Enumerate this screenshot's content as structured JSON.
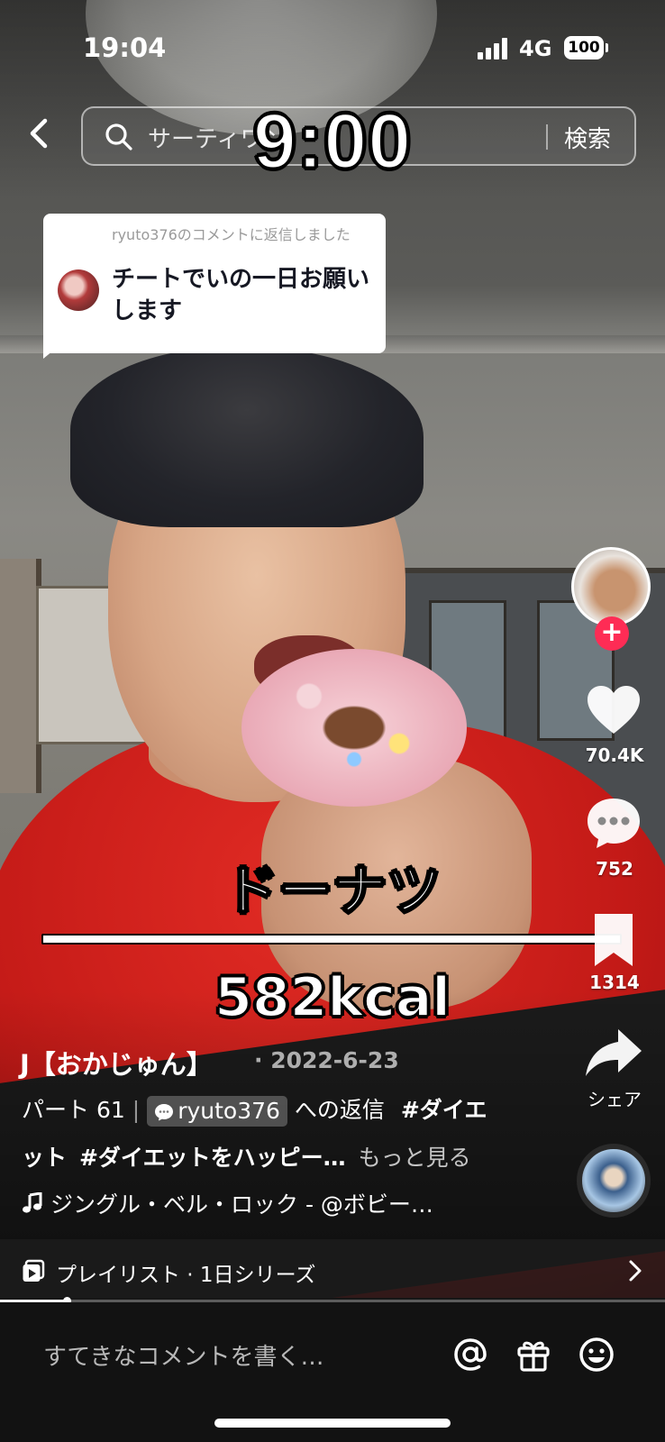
{
  "status_bar": {
    "time": "19:04",
    "network": "4G",
    "battery": "100"
  },
  "search": {
    "query": "サーティワン",
    "button_label": "検索"
  },
  "video_overlay": {
    "timer": "9:00",
    "food_name": "ドーナツ",
    "calories": "582kcal"
  },
  "reply_card": {
    "meta": "ryuto376のコメントに返信しました",
    "text": "チートでいの一日お願いします"
  },
  "actions": {
    "likes": "70.4K",
    "comments": "752",
    "saves": "1314",
    "share_label": "シェア"
  },
  "post": {
    "author": "J【おかじゅん】",
    "date": "· 2022-6-23",
    "part": "パート 61",
    "reply_user": "ryuto376",
    "reply_suffix": "への返信",
    "hashtag1": "#ダイエ",
    "line2_hashtag_tail": "ット",
    "hashtag2": "#ダイエットをハッピー…",
    "more": "もっと見る",
    "music": "ジングル・ベル・ロック - @ボビー…"
  },
  "playlist": {
    "label": "プレイリスト · 1日シリーズ"
  },
  "progress": {
    "played_fraction": 0.1
  },
  "composer": {
    "placeholder": "すてきなコメントを書く…"
  },
  "colors": {
    "follow_accent": "#fe2c55",
    "composer_bg": "#121212"
  },
  "icons": [
    "back-chevron-icon",
    "search-icon",
    "heart-icon",
    "comment-bubble-icon",
    "bookmark-icon",
    "share-arrow-icon",
    "music-note-icon",
    "playlist-icon",
    "chevron-right-icon",
    "mention-icon",
    "gift-icon",
    "emoji-icon",
    "chat-bubble-icon"
  ]
}
